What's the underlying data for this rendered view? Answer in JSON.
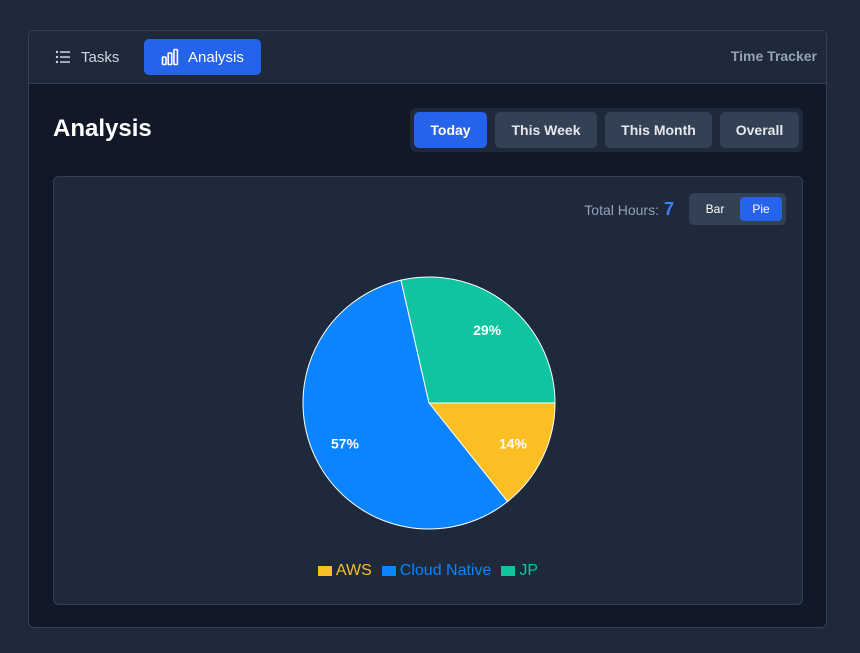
{
  "nav": {
    "tasks_label": "Tasks",
    "analysis_label": "Analysis",
    "app_title": "Time Tracker"
  },
  "page": {
    "title": "Analysis"
  },
  "range": {
    "options": [
      "Today",
      "This Week",
      "This Month",
      "Overall"
    ],
    "selected": "Today"
  },
  "summary": {
    "total_label": "Total Hours:",
    "total_value": "7"
  },
  "view": {
    "bar_label": "Bar",
    "pie_label": "Pie",
    "selected": "Pie"
  },
  "colors": {
    "accent": "#2563eb",
    "aws": "#fbbf24",
    "cloud_native": "#0a84ff",
    "jp": "#10c4a0"
  },
  "chart_data": {
    "type": "pie",
    "categories": [
      "AWS",
      "Cloud Native",
      "JP"
    ],
    "values": [
      1,
      4,
      2
    ],
    "percent_labels": [
      "14%",
      "57%",
      "29%"
    ],
    "colors": [
      "#fbbf24",
      "#0a84ff",
      "#10c4a0"
    ],
    "legend": "bottom"
  }
}
